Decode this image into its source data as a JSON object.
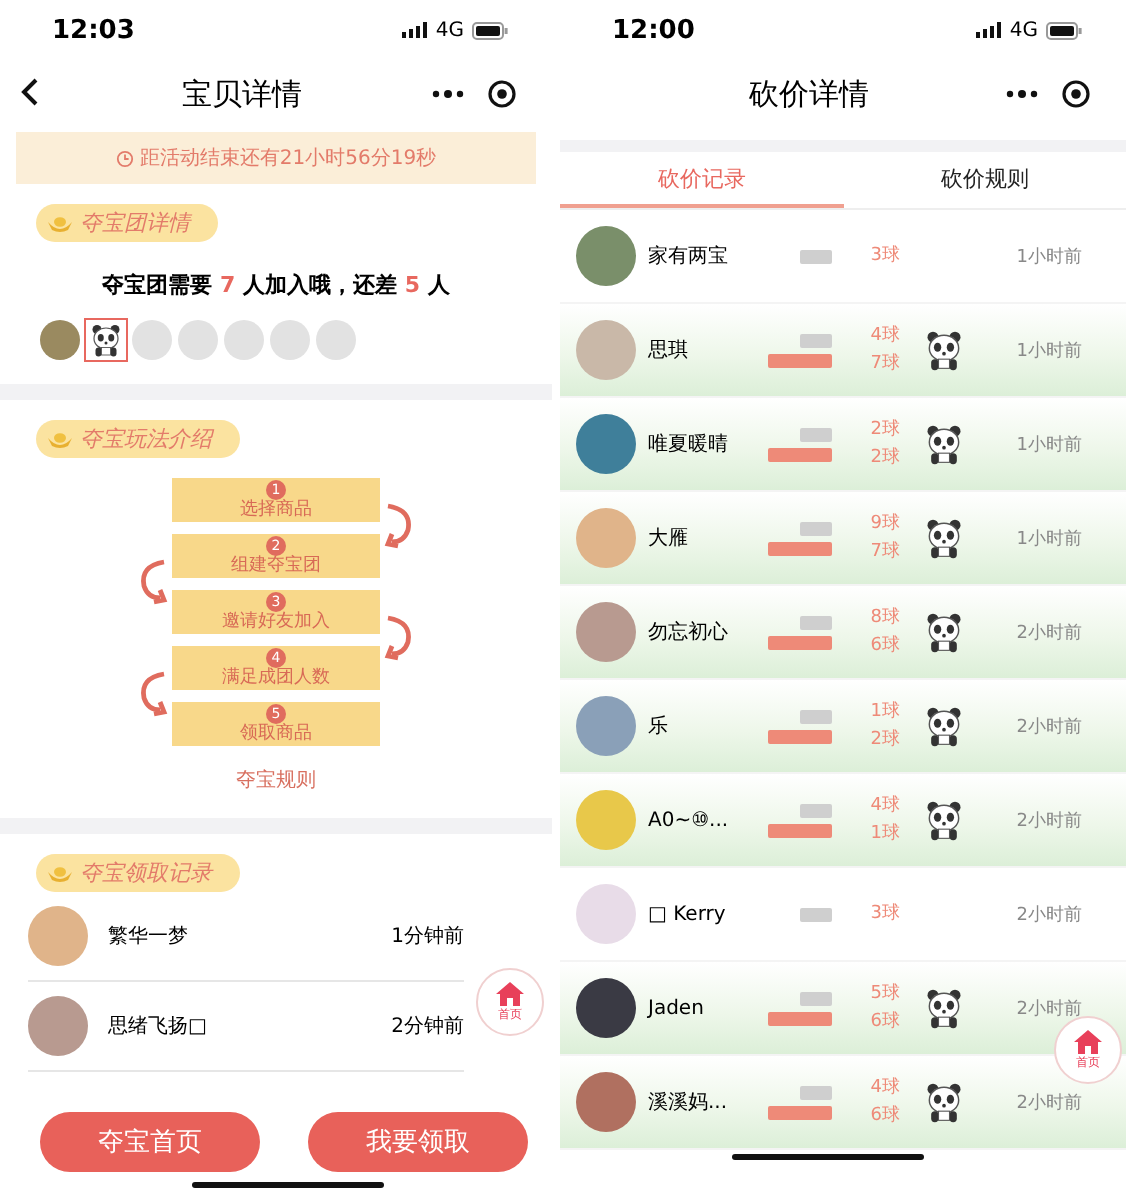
{
  "left_screen": {
    "status_bar": {
      "time": "12:03",
      "network": "4G"
    },
    "nav": {
      "title": "宝贝详情"
    },
    "countdown": "距活动结束还有21小时56分19秒",
    "team_section": {
      "heading": "夺宝团详情",
      "message": [
        {
          "text": "夺宝团需要 ",
          "highlight": false
        },
        {
          "text": "7",
          "highlight": true
        },
        {
          "text": " 人加入哦，还差 ",
          "highlight": false
        },
        {
          "text": "5",
          "highlight": true
        },
        {
          "text": " 人",
          "highlight": false
        }
      ],
      "members": [
        {
          "kind": "photo",
          "selected": false
        },
        {
          "kind": "panda",
          "selected": true
        },
        {
          "kind": "empty",
          "selected": false
        },
        {
          "kind": "empty",
          "selected": false
        },
        {
          "kind": "empty",
          "selected": false
        },
        {
          "kind": "empty",
          "selected": false
        },
        {
          "kind": "empty",
          "selected": false
        }
      ]
    },
    "howto_section": {
      "heading": "夺宝玩法介绍",
      "steps": [
        {
          "number": "1",
          "label": "选择商品"
        },
        {
          "number": "2",
          "label": "组建夺宝团"
        },
        {
          "number": "3",
          "label": "邀请好友加入"
        },
        {
          "number": "4",
          "label": "满足成团人数"
        },
        {
          "number": "5",
          "label": "领取商品"
        }
      ],
      "rules_link": "夺宝规则"
    },
    "records_section": {
      "heading": "夺宝领取记录",
      "rows": [
        {
          "name": "繁华一梦",
          "time": "1分钟前"
        },
        {
          "name": "思绪飞扬□",
          "time": "2分钟前"
        }
      ]
    },
    "home_float": "首页",
    "buttons": [
      "夺宝首页",
      "我要领取"
    ]
  },
  "right_screen": {
    "status_bar": {
      "time": "12:00",
      "network": "4G"
    },
    "nav": {
      "title": "砍价详情"
    },
    "tabs": [
      {
        "label": "砍价记录",
        "selected": true
      },
      {
        "label": "砍价规则",
        "selected": false
      }
    ],
    "rows": [
      {
        "name": "家有两宝",
        "counts": [
          "3球"
        ],
        "time": "1小时前",
        "boosted": false
      },
      {
        "name": "思琪",
        "counts": [
          "4球",
          "7球"
        ],
        "time": "1小时前",
        "boosted": true
      },
      {
        "name": "唯夏暖晴",
        "counts": [
          "2球",
          "2球"
        ],
        "time": "1小时前",
        "boosted": true
      },
      {
        "name": "大雁",
        "counts": [
          "9球",
          "7球"
        ],
        "time": "1小时前",
        "boosted": true
      },
      {
        "name": "勿忘初心",
        "counts": [
          "8球",
          "6球"
        ],
        "time": "2小时前",
        "boosted": true
      },
      {
        "name": "乐",
        "counts": [
          "1球",
          "2球"
        ],
        "time": "2小时前",
        "boosted": true
      },
      {
        "name": "A0~⑩...",
        "counts": [
          "4球",
          "1球"
        ],
        "time": "2小时前",
        "boosted": true
      },
      {
        "name": "□ Kerry",
        "counts": [
          "3球"
        ],
        "time": "2小时前",
        "boosted": false
      },
      {
        "name": "Jaden",
        "counts": [
          "5球",
          "6球"
        ],
        "time": "2小时前",
        "boosted": true
      },
      {
        "name": "溪溪妈...",
        "counts": [
          "4球",
          "6球"
        ],
        "time": "2小时前",
        "boosted": true
      }
    ],
    "home_float": "首页"
  }
}
